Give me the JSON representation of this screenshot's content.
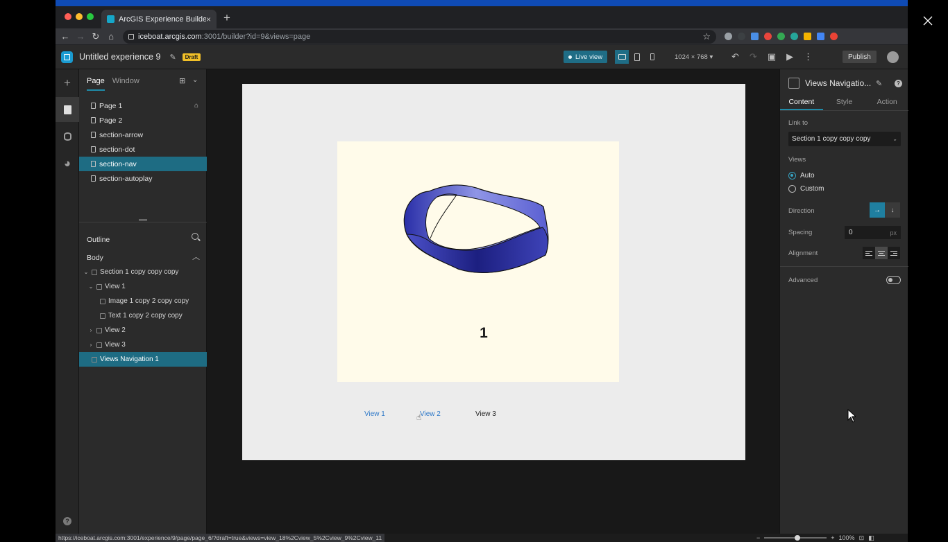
{
  "browser": {
    "tab_title": "ArcGIS Experience Builder",
    "tab_close": "×",
    "new_tab": "+",
    "url_host": "iceboat.arcgis.com",
    "url_path": ":3001/builder?id=9&views=page",
    "status_url": "https://iceboat.arcgis.com:3001/experience/9/page/page_6/?draft=true&views=view_18%2Cview_5%2Cview_9%2Cview_11",
    "zoom": "100%"
  },
  "app": {
    "title": "Untitled experience 9",
    "draft_badge": "Draft",
    "live_view": "Live view",
    "size_select": "1024 × 768",
    "publish": "Publish",
    "accent": "#1f6d86"
  },
  "left_panel": {
    "tabs": [
      "Page",
      "Window"
    ],
    "pages": [
      "Page 1",
      "Page 2",
      "section-arrow",
      "section-dot",
      "section-nav",
      "section-autoplay"
    ],
    "selected_page": "section-nav",
    "outline_title": "Outline",
    "body_label": "Body",
    "outline": [
      {
        "label": "Section 1 copy copy copy",
        "chev": "⌄"
      },
      {
        "label": "View 1",
        "chev": "⌄"
      },
      {
        "label": "Image 1 copy 2 copy copy",
        "chev": ""
      },
      {
        "label": "Text 1 copy 2 copy copy",
        "chev": ""
      },
      {
        "label": "View 2",
        "chev": "›"
      },
      {
        "label": "View 3",
        "chev": "›"
      },
      {
        "label": "Views Navigation 1",
        "chev": ""
      }
    ]
  },
  "canvas": {
    "view_number": "1",
    "nav_items": [
      "View 1",
      "View 2",
      "View 3"
    ]
  },
  "right_panel": {
    "widget_title": "Views Navigatio...",
    "tabs": [
      "Content",
      "Style",
      "Action"
    ],
    "link_to_label": "Link to",
    "link_to_value": "Section 1 copy copy copy",
    "views_label": "Views",
    "view_options": [
      "Auto",
      "Custom"
    ],
    "direction_label": "Direction",
    "spacing_label": "Spacing",
    "spacing_value": "0",
    "spacing_unit": "px",
    "alignment_label": "Alignment",
    "advanced_label": "Advanced"
  }
}
